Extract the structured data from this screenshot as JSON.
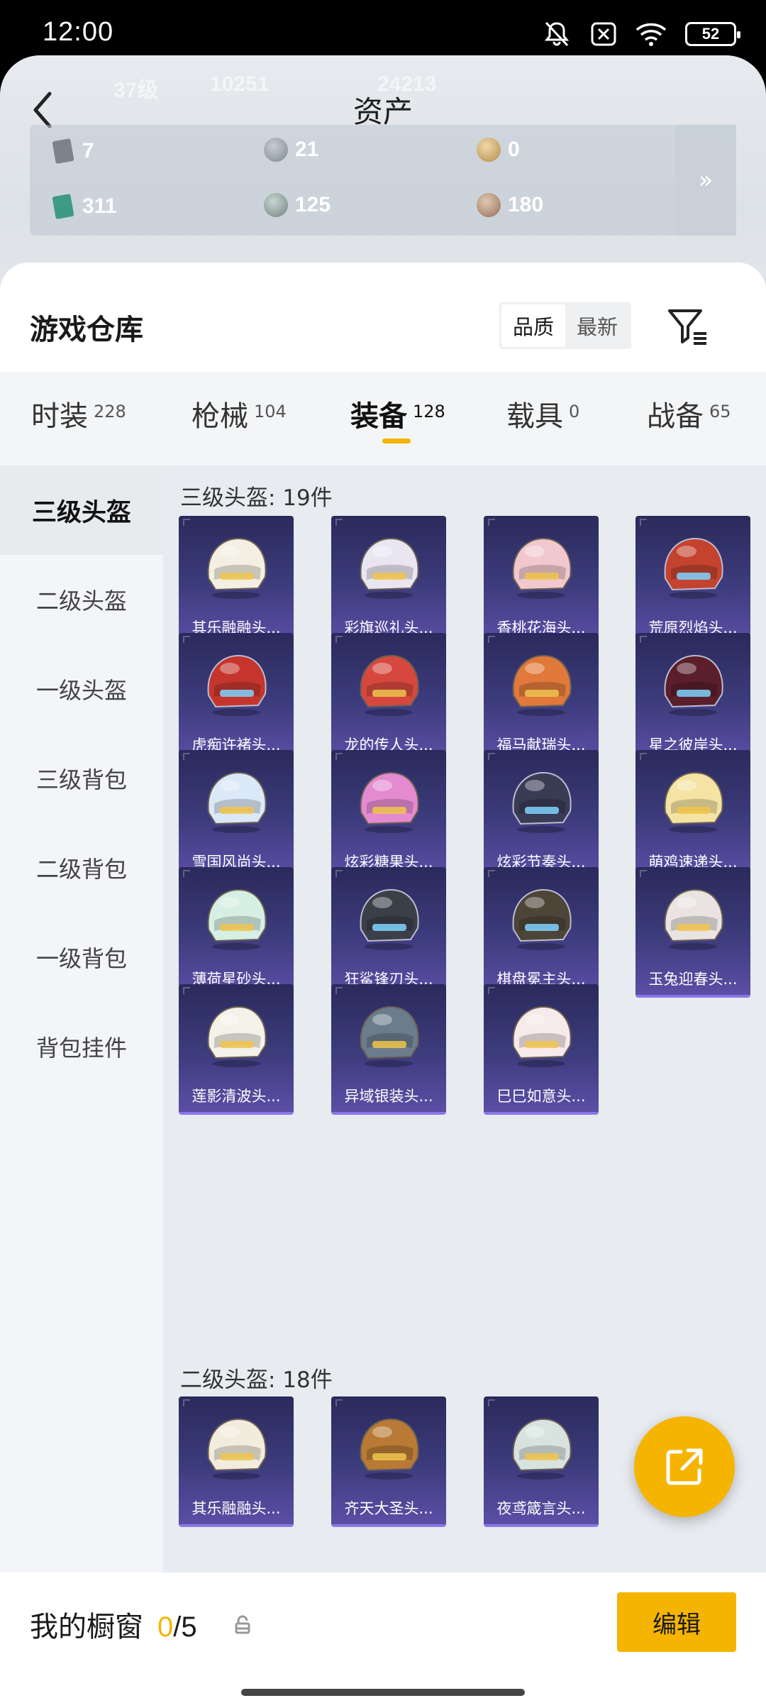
{
  "status_bar": {
    "time": "12:00",
    "battery": "52"
  },
  "header": {
    "title": "资产",
    "ghost_texts": [
      "37级",
      "10251",
      "24213"
    ],
    "assets": [
      {
        "value": "7",
        "color": "#8a8f98"
      },
      {
        "value": "21",
        "color": "#8f9aa6"
      },
      {
        "value": "0",
        "color": "#c9a46b"
      },
      {
        "value": "311",
        "color": "#3f9a84"
      },
      {
        "value": "125",
        "color": "#8c9c98"
      },
      {
        "value": "180",
        "color": "#b08e74"
      }
    ],
    "more": "»"
  },
  "warehouse": {
    "title": "游戏仓库",
    "sort": {
      "quality": "品质",
      "newest": "最新"
    }
  },
  "tabs": [
    {
      "label": "时装",
      "count": "228"
    },
    {
      "label": "枪械",
      "count": "104"
    },
    {
      "label": "装备",
      "count": "128"
    },
    {
      "label": "载具",
      "count": "0"
    },
    {
      "label": "战备",
      "count": "65"
    }
  ],
  "sidebar": [
    "三级头盔",
    "二级头盔",
    "一级头盔",
    "三级背包",
    "二级背包",
    "一级背包",
    "背包挂件"
  ],
  "sections": [
    {
      "title": "三级头盔: 19件",
      "items": [
        "其乐融融头...",
        "彩旗巡礼头...",
        "香桃花海头...",
        "荒原烈焰头...",
        "虎痴许褚头...",
        "龙的传人头...",
        "福马献瑞头...",
        "星之彼岸头...",
        "雪国风尚头...",
        "炫彩糖果头...",
        "炫彩节奏头...",
        "萌鸡速递头...",
        "薄荷星砂头...",
        "狂鲨锋刃头...",
        "棋盘冕主头...",
        "玉兔迎春头...",
        "莲影清波头...",
        "异域银装头...",
        "巳巳如意头..."
      ]
    },
    {
      "title": "二级头盔: 18件",
      "items": [
        "其乐融融头...",
        "齐天大圣头...",
        "夜鸢箴言头..."
      ]
    }
  ],
  "helmet_colors": [
    "#f3efe2",
    "#e9e6f2",
    "#f2c8cf",
    "#c4432e",
    "#c5352e",
    "#d6483d",
    "#e0793a",
    "#5a1f2b",
    "#dbe8f7",
    "#e48ad0",
    "#3a3b55",
    "#f4e3a2",
    "#d5efe4",
    "#3b3f48",
    "#4c4538",
    "#e9e4e2",
    "#f4f1e8",
    "#6b7d8c",
    "#f6eaea",
    "#f2ecdc",
    "#b87a35",
    "#d8e3e0",
    "#f0ede8"
  ],
  "bottom": {
    "showcase_label": "我的橱窗",
    "showcase_current": "0",
    "showcase_total": "/5",
    "edit_label": "编辑"
  }
}
